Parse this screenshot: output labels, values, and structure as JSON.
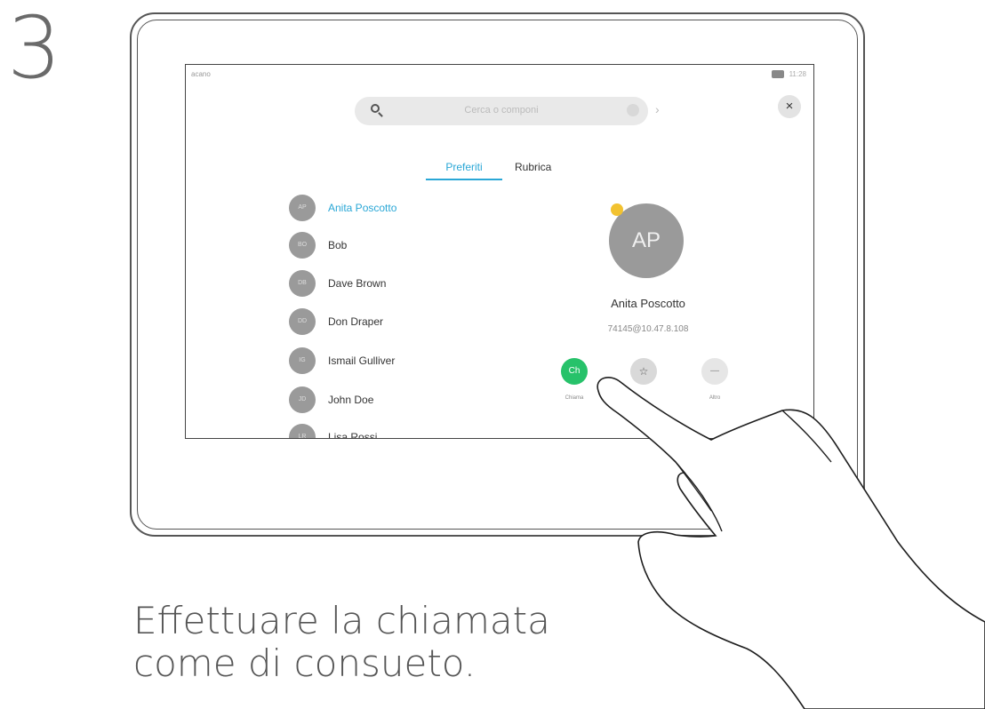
{
  "step_number": "3",
  "status": {
    "left": "acano",
    "time": "11:28"
  },
  "search": {
    "placeholder": "Cerca o componi"
  },
  "close_label": "×",
  "tabs": [
    {
      "label": "Preferiti",
      "active": true
    },
    {
      "label": "Rubrica",
      "active": false
    }
  ],
  "contacts": [
    {
      "initials": "AP",
      "name": "Anita Poscotto",
      "selected": true
    },
    {
      "initials": "BO",
      "name": "Bob"
    },
    {
      "initials": "DB",
      "name": "Dave Brown"
    },
    {
      "initials": "DD",
      "name": "Don Draper"
    },
    {
      "initials": "IG",
      "name": "Ismail Gulliver"
    },
    {
      "initials": "JD",
      "name": "John Doe"
    },
    {
      "initials": "LR",
      "name": "Lisa Rossi"
    }
  ],
  "detail": {
    "initials": "AP",
    "name": "Anita Poscotto",
    "address": "74145@10.47.8.108",
    "actions": [
      {
        "icon": "call-icon",
        "glyph": "Ch",
        "label": "Chiama"
      },
      {
        "icon": "star-icon",
        "glyph": "☆",
        "label": ""
      },
      {
        "icon": "more-icon",
        "glyph": "—",
        "label": "Altro"
      }
    ]
  },
  "caption_lines": [
    "Effettuare la chiamata",
    "come di consueto."
  ],
  "colors": {
    "accent": "#2aa7d6",
    "call_green": "#27c26a",
    "favorite_star": "#f2c230"
  }
}
